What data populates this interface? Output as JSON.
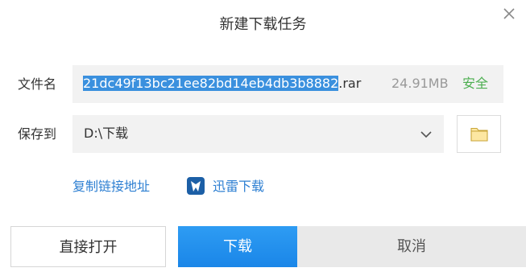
{
  "dialog": {
    "title": "新建下载任务"
  },
  "file": {
    "label": "文件名",
    "name_selected": "21dc49f13bc21ee82bd14eb4db3b8882",
    "name_extension": ".rar",
    "size": "24.91MB",
    "safety_status": "安全"
  },
  "save": {
    "label": "保存到",
    "path": "D:\\下载"
  },
  "links": {
    "copy_link": "复制链接地址",
    "xunlei": "迅雷下载"
  },
  "buttons": {
    "open_directly": "直接打开",
    "download": "下载",
    "cancel": "取消"
  },
  "colors": {
    "accent": "#1a86e8",
    "link": "#2d7fd2",
    "safe": "#4caf50",
    "selection": "#3a90de"
  },
  "icons": {
    "close": "close-icon",
    "chevron": "chevron-down-icon",
    "folder": "folder-icon",
    "xunlei": "xunlei-icon"
  }
}
